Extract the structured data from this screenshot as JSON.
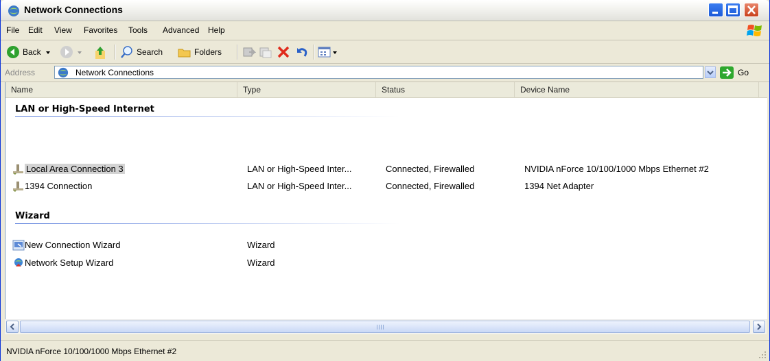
{
  "window": {
    "title": "Network Connections"
  },
  "menu": [
    "File",
    "Edit",
    "View",
    "Favorites",
    "Tools",
    "Advanced",
    "Help"
  ],
  "toolbar": {
    "back": "Back",
    "search": "Search",
    "folders": "Folders"
  },
  "address": {
    "label": "Address",
    "value": "Network Connections",
    "go": "Go"
  },
  "columns": [
    "Name",
    "Type",
    "Status",
    "Device Name"
  ],
  "groups": [
    {
      "title": "LAN or High-Speed Internet",
      "items": [
        {
          "name": "Local Area Connection 3",
          "type": "LAN or High-Speed Inter...",
          "status": "Connected, Firewalled",
          "device": "NVIDIA nForce 10/100/1000 Mbps Ethernet #2",
          "icon": "network-connection-icon",
          "selected": true
        },
        {
          "name": "1394 Connection",
          "type": "LAN or High-Speed Inter...",
          "status": "Connected, Firewalled",
          "device": "1394 Net Adapter",
          "icon": "network-connection-icon",
          "selected": false
        }
      ]
    },
    {
      "title": "Wizard",
      "items": [
        {
          "name": "New Connection Wizard",
          "type": "Wizard",
          "icon": "new-connection-wizard-icon"
        },
        {
          "name": "Network Setup Wizard",
          "type": "Wizard",
          "icon": "network-setup-wizard-icon"
        }
      ]
    }
  ],
  "status_bar": {
    "text": "NVIDIA nForce 10/100/1000 Mbps Ethernet #2"
  },
  "colors": {
    "titlebar": "#ece9d8",
    "selection": "#d3d3d3",
    "group_heading": "#000000"
  }
}
